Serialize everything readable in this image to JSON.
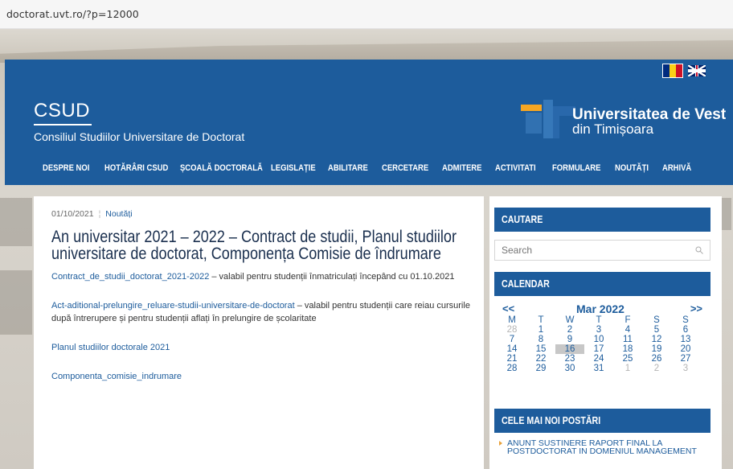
{
  "browser": {
    "url": "doctorat.uvt.ro/?p=12000"
  },
  "header": {
    "site_title": "CSUD",
    "site_subtitle": "Consiliul Studiilor Universitare de Doctorat",
    "university_line1": "Universitatea de Vest",
    "university_line2": "din Timișoara",
    "colors": {
      "primary": "#1d5c9c",
      "accent": "#f5a623"
    }
  },
  "nav": {
    "items": [
      {
        "label": "DESPRE NOI"
      },
      {
        "label": "HOTĂRÂRI CSUD"
      },
      {
        "label": "ȘCOALĂ DOCTORALĂ"
      },
      {
        "label": "LEGISLAȚIE"
      },
      {
        "label": "ABILITARE"
      },
      {
        "label": "CERCETARE"
      },
      {
        "label": "ADMITERE"
      },
      {
        "label": "ACTIVITATI"
      },
      {
        "label": "FORMULARE"
      },
      {
        "label": "NOUTĂȚI"
      },
      {
        "label": "ARHIVĂ"
      }
    ]
  },
  "post": {
    "date": "01/10/2021",
    "category": "Noutăți",
    "title": "An universitar 2021 – 2022 – Contract de studii, Planul studiilor universitare de doctorat, Componența Comisie de îndrumare",
    "paragraphs": [
      {
        "link": "Contract_de_studii_doctorat_2021-2022",
        "text": " – valabil pentru studenții înmatriculați începând cu 01.10.2021"
      },
      {
        "link": "Act-aditional-prelungire_reluare-studii-universitare-de-doctorat",
        "text": " – valabil pentru studenții care reiau cursurile după întrerupere și pentru studenții aflați în prelungire de școlaritate"
      },
      {
        "link": "Planul studiilor doctorale 2021",
        "text": ""
      },
      {
        "link": "Componenta_comisie_indrumare",
        "text": ""
      }
    ]
  },
  "sidebar": {
    "search_title": "CAUTARE",
    "search_placeholder": "Search",
    "calendar_title": "CALENDAR",
    "calendar": {
      "prev": "<<",
      "next": ">>",
      "month": "Mar 2022",
      "weekdays": [
        "M",
        "T",
        "W",
        "T",
        "F",
        "S",
        "S"
      ],
      "weeks": [
        [
          "28",
          "1",
          "2",
          "3",
          "4",
          "5",
          "6"
        ],
        [
          "7",
          "8",
          "9",
          "10",
          "11",
          "12",
          "13"
        ],
        [
          "14",
          "15",
          "16",
          "17",
          "18",
          "19",
          "20"
        ],
        [
          "21",
          "22",
          "23",
          "24",
          "25",
          "26",
          "27"
        ],
        [
          "28",
          "29",
          "30",
          "31",
          "1",
          "2",
          "3"
        ]
      ],
      "other_month": [
        [
          0,
          0
        ],
        [
          4,
          4
        ],
        [
          4,
          5
        ],
        [
          4,
          6
        ]
      ],
      "today": [
        2,
        2
      ]
    },
    "latest_title": "CELE MAI NOI POSTĂRI",
    "latest_posts": [
      "ANUNT SUSTINERE RAPORT FINAL LA POSTDOCTORAT IN DOMENIUL MANAGEMENT"
    ]
  }
}
